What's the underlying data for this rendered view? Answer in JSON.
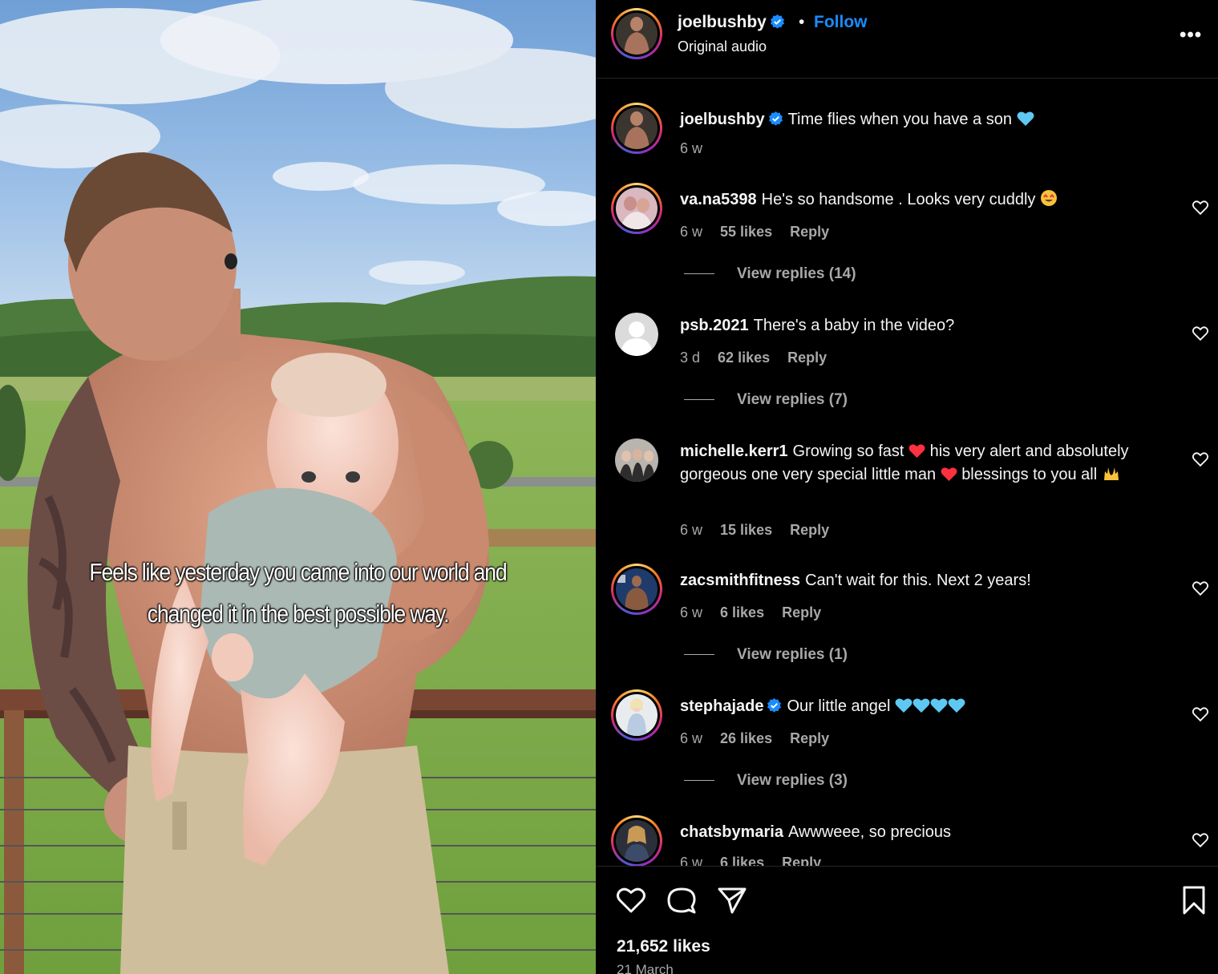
{
  "post": {
    "video_caption_lines": [
      "Feels like yesterday you came into our world and",
      "changed it in the best possible way."
    ]
  },
  "header": {
    "username": "joelbushby",
    "separator": "•",
    "follow_label": "Follow",
    "audio": "Original audio",
    "more_icon": "•••"
  },
  "caption": {
    "username": "joelbushby",
    "text": "Time flies when you have a son",
    "time": "6 w"
  },
  "comments": [
    {
      "username": "va.na5398",
      "text": "He's so handsome . Looks very cuddly",
      "time": "6 w",
      "likes": "55 likes",
      "reply": "Reply",
      "view_replies": "View replies (14)"
    },
    {
      "username": "psb.2021",
      "text": "There's a baby in the video?",
      "time": "3 d",
      "likes": "62 likes",
      "reply": "Reply",
      "view_replies": "View replies (7)"
    },
    {
      "username": "michelle.kerr1",
      "text_parts": [
        "Growing so fast",
        "his very alert and absolutely gorgeous one very special little man",
        "blessings to you all"
      ],
      "time": "6 w",
      "likes": "15 likes",
      "reply": "Reply"
    },
    {
      "username": "zacsmithfitness",
      "text": "Can't wait for this. Next 2 years!",
      "time": "6 w",
      "likes": "6 likes",
      "reply": "Reply",
      "view_replies": "View replies (1)"
    },
    {
      "username": "stephajade",
      "text": "Our little angel",
      "time": "6 w",
      "likes": "26 likes",
      "reply": "Reply",
      "view_replies": "View replies (3)"
    },
    {
      "username": "chatsbymaria",
      "text": "Awwweee, so precious",
      "time": "6 w",
      "likes": "6 likes",
      "reply": "Reply"
    }
  ],
  "footer": {
    "likes": "21,652 likes",
    "date": "21 March"
  },
  "colors": {
    "follow": "#1a8cff",
    "verified": "#1a8cff",
    "secondary_text": "#a8a8a8",
    "heart_emoji": "#ff3040",
    "blue_heart": "#5ec8f2"
  },
  "icons": [
    "verified-badge-icon",
    "more-options-icon",
    "heart-icon",
    "comment-icon",
    "share-icon",
    "bookmark-icon"
  ]
}
